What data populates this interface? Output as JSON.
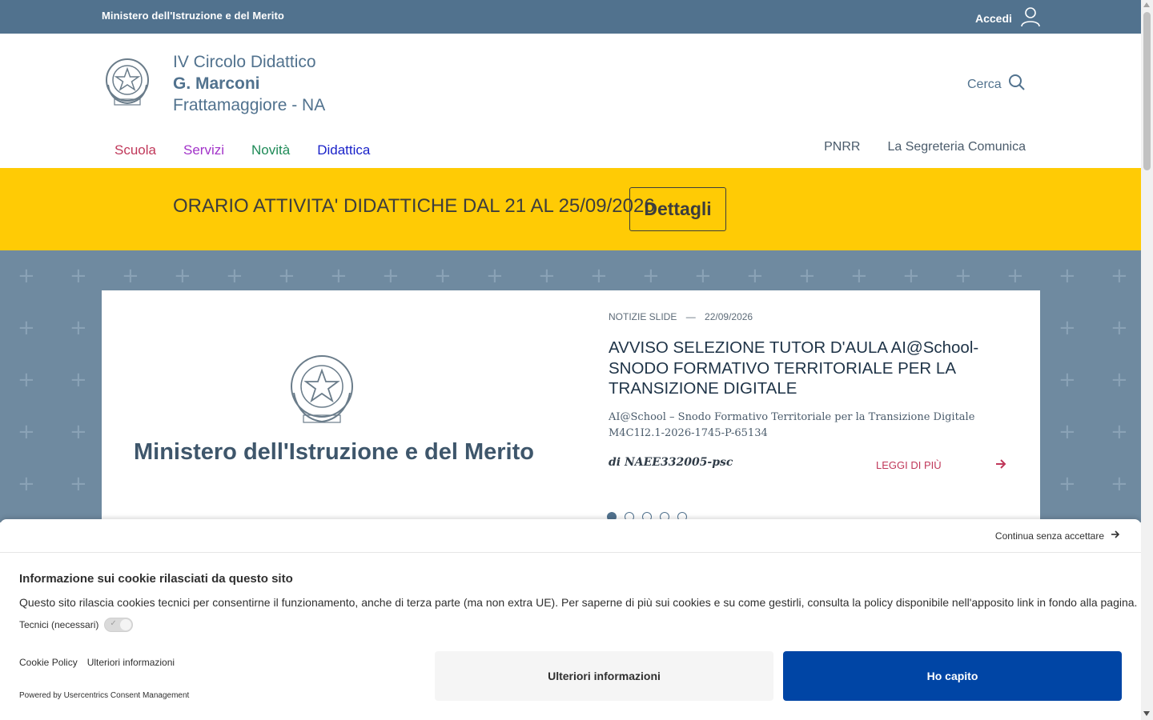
{
  "topbar": {
    "ministry": "Ministero dell'Istruzione e del Merito",
    "login_label": "Accedi",
    "login_icon": "user-icon"
  },
  "header": {
    "school_line1": "IV Circolo Didattico",
    "school_line2": "G. Marconi",
    "school_line3": "Frattamaggiore - NA",
    "search_label": "Cerca",
    "search_icon": "search-icon"
  },
  "nav": {
    "main": [
      "Scuola",
      "Servizi",
      "Novità",
      "Didattica"
    ],
    "secondary": [
      "PNRR",
      "La Segreteria Comunica"
    ]
  },
  "alert": {
    "text": "ORARIO ATTIVITA' DIDATTICHE DAL 21 AL 25/09/2026",
    "button": "Dettagli",
    "background": "#ffcb05"
  },
  "slide": {
    "image_text": "Ministero dell'Istruzione e del Merito",
    "category": "NOTIZIE SLIDE",
    "separator": "—",
    "date": "22/09/2026",
    "title": "AVVISO SELEZIONE TUTOR D'AULA AI@School-SNODO FORMATIVO TERRITORIALE PER LA TRANSIZIONE DIGITALE",
    "description": "AI@School – Snodo Formativo Territoriale per la Transizione Digitale M4C1I2.1-2026-1745-P-65134",
    "author": "di NAEE332005-psc",
    "read_more": "LEGGI DI PIÙ",
    "slide_count": 5,
    "active_slide": 1
  },
  "cookie": {
    "continue": "Continua senza accettare",
    "heading": "Informazione sui cookie rilasciati da questo sito",
    "body": "Questo sito rilascia cookies tecnici per consentirne il funzionamento, anche di terza parte (ma non extra UE). Per saperne di più sui cookies e su come gestirli, consulta la policy disponibile nell'apposito link in fondo alla pagina.",
    "toggle_label": "Tecnici (necessari)",
    "link_policy": "Cookie Policy",
    "link_more": "Ulteriori informazioni",
    "powered": "Powered by Usercentrics Consent Management",
    "button_more": "Ulteriori informazioni",
    "button_ok": "Ho capito",
    "accent": "#0045a5"
  },
  "colors": {
    "topbar": "#51728e",
    "hero_bg": "#6f8aa0",
    "nav_scuola": "#c0385a",
    "nav_servizi": "#a233c9",
    "nav_novita": "#1e8a57",
    "nav_didattica": "#1a22c9"
  }
}
